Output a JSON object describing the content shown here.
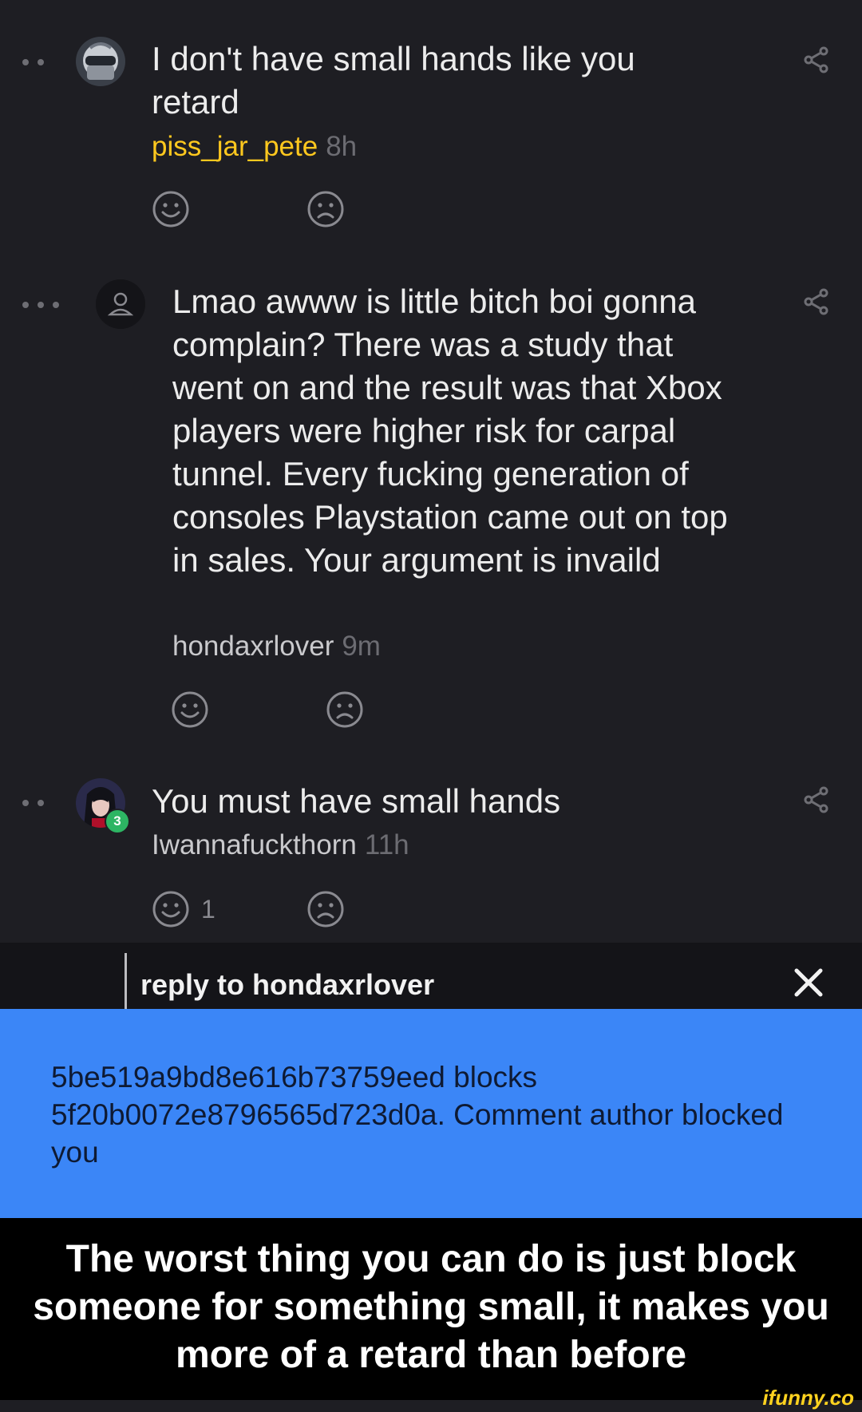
{
  "comments": [
    {
      "text": "I don't have small hands like you retard",
      "author": "piss_jar_pete",
      "time": "8h",
      "smile_count": ""
    },
    {
      "text": "Lmao awww is little bitch boi gonna complain? There was a study that went on and the result was that Xbox players were higher risk for carpal tunnel. Every fucking generation of consoles Playstation came out on top in sales. Your argument is invaild",
      "author": "hondaxrlover",
      "time": "9m",
      "smile_count": ""
    },
    {
      "text": "You must have small hands",
      "author": "Iwannafuckthorn",
      "time": "11h",
      "smile_count": "1",
      "badge": "3"
    }
  ],
  "reply_bar": {
    "label": "reply to hondaxrlover"
  },
  "toast": {
    "message": "5be519a9bd8e616b73759eed blocks 5f20b0072e8796565d723d0a. Comment author blocked you"
  },
  "caption": {
    "text": "The worst thing you can do is just block someone for something small, it makes you more of a retard than before"
  },
  "watermark": {
    "text": "ifunny.co"
  },
  "icons": {
    "share": "share-icon",
    "smile": "smile-icon",
    "frown": "frown-icon",
    "close": "close-icon",
    "more": "more-dots-icon"
  },
  "colors": {
    "background": "#1e1e23",
    "op_author": "#ffc81e",
    "toast": "#3b86f7",
    "caption_bg": "#000000",
    "badge": "#2db563",
    "watermark": "#ffd21f"
  }
}
